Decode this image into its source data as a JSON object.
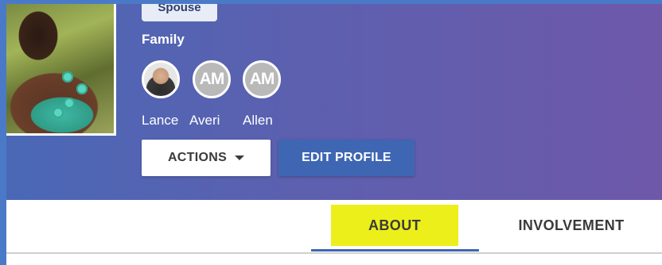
{
  "profile": {
    "badge_label": "Spouse",
    "family_label": "Family",
    "family_members": [
      {
        "name": "Lance",
        "initials": "",
        "has_photo": true
      },
      {
        "name": "Averi",
        "initials": "AM",
        "has_photo": false
      },
      {
        "name": "Allen",
        "initials": "AM",
        "has_photo": false
      }
    ]
  },
  "actions": {
    "actions_label": "ACTIONS",
    "edit_profile_label": "EDIT PROFILE"
  },
  "tabs": [
    {
      "label": "ABOUT",
      "active": true
    },
    {
      "label": "INVOLVEMENT",
      "active": false
    }
  ],
  "colors": {
    "hero_gradient_start": "#4a68b6",
    "hero_gradient_end": "#6e58aa",
    "primary": "#3f66b3",
    "highlight": "#ecef1a"
  },
  "icons": {
    "actions_caret": "caret-down-icon"
  }
}
